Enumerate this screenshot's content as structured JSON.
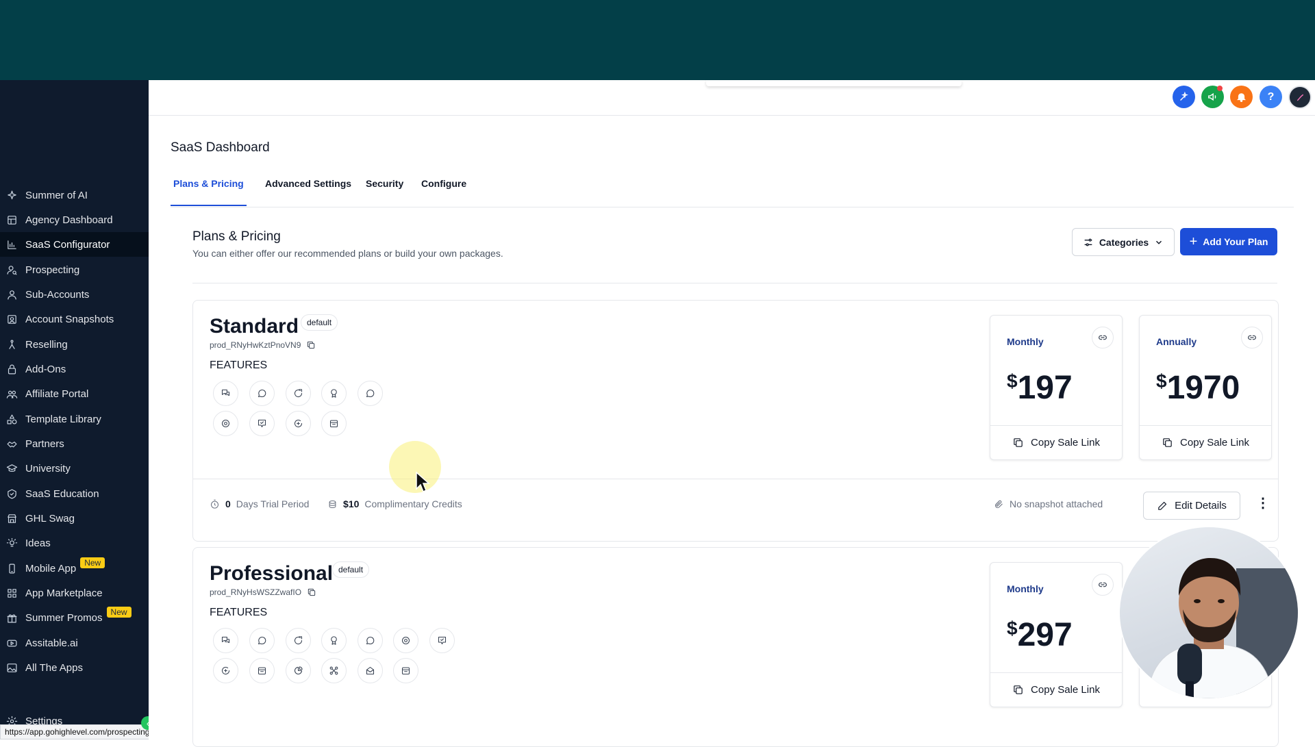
{
  "header": {
    "icons": [
      "magic-sparkle-icon",
      "megaphone-icon",
      "bell-icon",
      "help-icon",
      "user-avatar"
    ],
    "help_label": "?",
    "colors": {
      "topband": "#033f48",
      "sidebar": "#0f1b2d",
      "accent": "#1d4ed8"
    }
  },
  "sidebar": {
    "items": [
      {
        "label": "Summer of AI",
        "icon": "sparkle-icon"
      },
      {
        "label": "Agency Dashboard",
        "icon": "dashboard-icon"
      },
      {
        "label": "SaaS Configurator",
        "icon": "chart-icon",
        "active": true
      },
      {
        "label": "Prospecting",
        "icon": "user-search-icon"
      },
      {
        "label": "Sub-Accounts",
        "icon": "user-icon"
      },
      {
        "label": "Account Snapshots",
        "icon": "snapshot-icon"
      },
      {
        "label": "Reselling",
        "icon": "reselling-icon"
      },
      {
        "label": "Add-Ons",
        "icon": "lock-bag-icon"
      },
      {
        "label": "Affiliate Portal",
        "icon": "users-icon"
      },
      {
        "label": "Template Library",
        "icon": "shapes-icon"
      },
      {
        "label": "Partners",
        "icon": "handshake-icon"
      },
      {
        "label": "University",
        "icon": "graduation-cap-icon"
      },
      {
        "label": "SaaS Education",
        "icon": "education-icon"
      },
      {
        "label": "GHL Swag",
        "icon": "store-icon"
      },
      {
        "label": "Ideas",
        "icon": "lightbulb-icon"
      },
      {
        "label": "Mobile App",
        "icon": "mobile-icon",
        "badge": "New"
      },
      {
        "label": "App Marketplace",
        "icon": "grid-icon"
      },
      {
        "label": "Summer Promos",
        "icon": "gift-icon",
        "badge": "New"
      },
      {
        "label": "Assitable.ai",
        "icon": "video-icon"
      },
      {
        "label": "All The Apps",
        "icon": "image-icon"
      }
    ],
    "settings_label": "Settings",
    "status_url": "https://app.gohighlevel.com/prospecting",
    "collapse_label": "‹"
  },
  "page": {
    "title": "SaaS Dashboard",
    "tabs": [
      "Plans & Pricing",
      "Advanced Settings",
      "Security",
      "Configure"
    ],
    "active_tab": "Plans & Pricing"
  },
  "section": {
    "title": "Plans & Pricing",
    "subtitle": "You can either offer our recommended plans or build your own packages.",
    "categories_label": "Categories",
    "add_plan_label": "Add Your Plan"
  },
  "plans": [
    {
      "name": "Standard",
      "badge": "default",
      "product_id": "prod_RNyHwKztPnoVN9",
      "features_label": "FEATURES",
      "feature_icons": [
        "chat-bubbles-icon",
        "whatsapp-icon",
        "phone-chat-icon",
        "award-icon",
        "message-circle-icon",
        "target-icon",
        "shield-chat-icon",
        "review-icon",
        "calendar-icon"
      ],
      "prices": [
        {
          "period": "Monthly",
          "currency": "$",
          "amount": "197",
          "copy_label": "Copy Sale Link"
        },
        {
          "period": "Annually",
          "currency": "$",
          "amount": "1970",
          "copy_label": "Copy Sale Link"
        }
      ],
      "trial_days": "0",
      "trial_label": "Days Trial Period",
      "credits": "$10",
      "credits_label": "Complimentary Credits",
      "snapshot_label": "No snapshot attached",
      "edit_label": "Edit Details"
    },
    {
      "name": "Professional",
      "badge": "default",
      "product_id": "prod_RNyHsWSZZwafIO",
      "features_label": "FEATURES",
      "feature_icons": [
        "chat-bubbles-icon",
        "whatsapp-icon",
        "phone-chat-icon",
        "award-icon",
        "message-circle-icon",
        "target-icon",
        "shield-chat-icon",
        "review-icon",
        "calendar-icon",
        "pie-chart-icon",
        "workflow-icon",
        "mail-icon",
        "table-icon"
      ],
      "prices": [
        {
          "period": "Monthly",
          "currency": "$",
          "amount": "297",
          "copy_label": "Copy Sale Link"
        }
      ]
    }
  ]
}
